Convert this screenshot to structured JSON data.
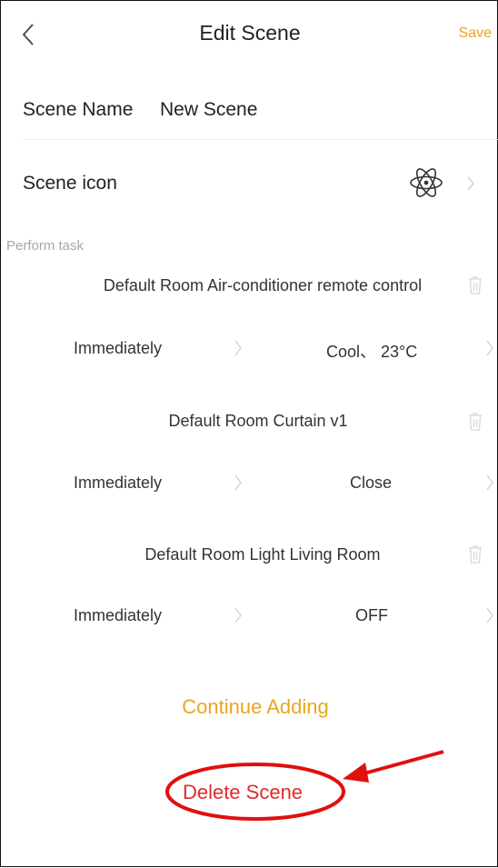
{
  "header": {
    "title": "Edit Scene",
    "save_label": "Save"
  },
  "scene_name": {
    "label": "Scene Name",
    "value": "New Scene"
  },
  "scene_icon": {
    "label": "Scene icon",
    "icon": "atom-icon"
  },
  "perform_task": {
    "section_label": "Perform task",
    "tasks": [
      {
        "title": "Default Room Air-conditioner remote control",
        "timing": "Immediately",
        "action": "Cool、 23°C"
      },
      {
        "title": "Default Room Curtain v1",
        "timing": "Immediately",
        "action": "Close"
      },
      {
        "title": "Default Room Light Living Room",
        "timing": "Immediately",
        "action": "OFF"
      }
    ]
  },
  "actions": {
    "continue_adding": "Continue Adding",
    "delete_scene": "Delete Scene"
  },
  "colors": {
    "accent": "#e9a61f",
    "delete": "#e22a2a",
    "annotation": "#e01010"
  }
}
